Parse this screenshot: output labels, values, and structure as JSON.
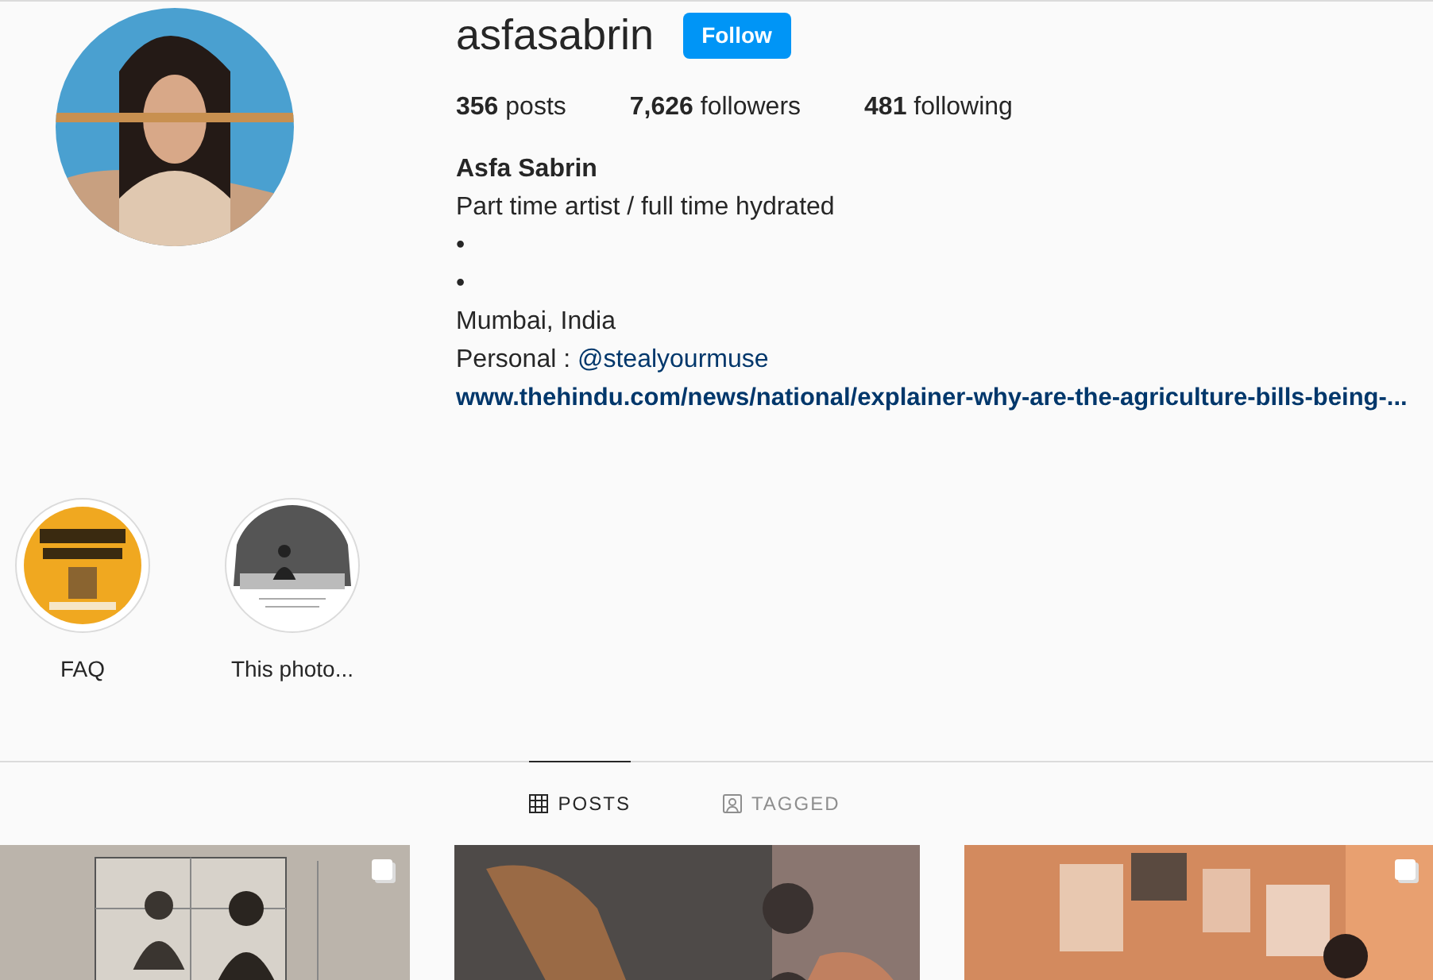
{
  "profile": {
    "username": "asfasabrin",
    "follow_button": "Follow",
    "stats": [
      "**356** posts",
      "**7,626** followers",
      "**481** following"
    ],
    "full_name": "Asfa Sabrin",
    "bio_lines": [
      "Part time artist / full time hydrated",
      "•",
      "•",
      "Mumbai, India"
    ],
    "personal": {
      "label": "Personal : ",
      "handle": "@stealyourmuse"
    },
    "website": "www.thehindu.com/news/national/explainer-why-are-the-agriculture-bills-being-..."
  },
  "highlights": [
    {
      "label": "FAQ",
      "kind": "poster"
    },
    {
      "label": "This photo..."
    }
  ],
  "tabs": [
    {
      "label": "POSTS",
      "kind": "grid",
      "selected": true
    },
    {
      "label": "TAGGED",
      "kind": "tag",
      "selected": false
    }
  ],
  "posts": [
    {
      "kind": "sketch",
      "multiple": true
    },
    {
      "kind": "painting",
      "multiple": false
    },
    {
      "kind": "room",
      "multiple": true
    }
  ]
}
